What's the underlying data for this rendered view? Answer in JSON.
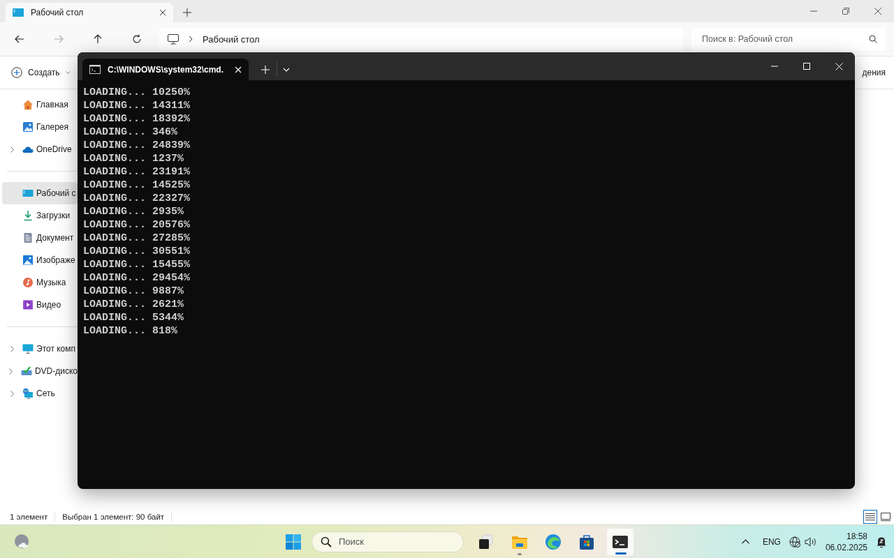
{
  "explorer": {
    "tab": {
      "title": "Рабочий стол",
      "selected": true
    },
    "address": {
      "location": "Рабочий стол"
    },
    "search": {
      "placeholder": "Поиск в: Рабочий стол"
    },
    "toolbar": {
      "create_label": "Создать",
      "right_label": "дения"
    },
    "sidebar": {
      "groups": [
        {
          "items": [
            {
              "label": "Главная",
              "kind": "home",
              "expandable": false,
              "selected": false
            },
            {
              "label": "Галерея",
              "kind": "gallery",
              "expandable": false,
              "selected": false
            },
            {
              "label": "OneDrive",
              "kind": "cloud",
              "expandable": true,
              "selected": false
            }
          ]
        },
        {
          "items": [
            {
              "label": "Рабочий с",
              "kind": "desktop",
              "expandable": false,
              "selected": true
            },
            {
              "label": "Загрузки",
              "kind": "download",
              "expandable": false,
              "selected": false
            },
            {
              "label": "Документ",
              "kind": "document",
              "expandable": false,
              "selected": false
            },
            {
              "label": "Изображе",
              "kind": "pictures",
              "expandable": false,
              "selected": false
            },
            {
              "label": "Музыка",
              "kind": "music",
              "expandable": false,
              "selected": false
            },
            {
              "label": "Видео",
              "kind": "video",
              "expandable": false,
              "selected": false
            }
          ]
        },
        {
          "items": [
            {
              "label": "Этот комп",
              "kind": "computer",
              "expandable": true,
              "selected": false
            },
            {
              "label": "DVD-диско",
              "kind": "dvd",
              "expandable": true,
              "selected": false
            },
            {
              "label": "Сеть",
              "kind": "network",
              "expandable": true,
              "selected": false
            }
          ]
        }
      ]
    },
    "status_bar": {
      "item_count": "1 элемент",
      "selection": "Выбран 1 элемент: 90 байт",
      "views": [
        {
          "kind": "details",
          "selected": true
        },
        {
          "kind": "tiles",
          "selected": false
        }
      ]
    }
  },
  "terminal": {
    "tab": {
      "title": "C:\\WINDOWS\\system32\\cmd."
    },
    "lines": [
      "LOADING... 10250%",
      "LOADING... 14311%",
      "LOADING... 18392%",
      "LOADING... 346%",
      "LOADING... 24839%",
      "LOADING... 1237%",
      "LOADING... 23191%",
      "LOADING... 14525%",
      "LOADING... 22327%",
      "LOADING... 2935%",
      "LOADING... 20576%",
      "LOADING... 27285%",
      "LOADING... 30551%",
      "LOADING... 15455%",
      "LOADING... 29454%",
      "LOADING... 9887%",
      "LOADING... 2621%",
      "LOADING... 5344%",
      "LOADING... 818%"
    ]
  },
  "taskbar": {
    "search": {
      "placeholder": "Поиск"
    },
    "apps": [
      {
        "kind": "task-view",
        "running": false,
        "active": false
      },
      {
        "kind": "explorer",
        "running": true,
        "active": false
      },
      {
        "kind": "edge",
        "running": false,
        "active": false
      },
      {
        "kind": "store",
        "running": false,
        "active": false
      },
      {
        "kind": "terminal",
        "running": true,
        "active": true
      }
    ],
    "tray": {
      "language": "ENG",
      "time": "18:58",
      "date": "06.02.2025"
    }
  }
}
